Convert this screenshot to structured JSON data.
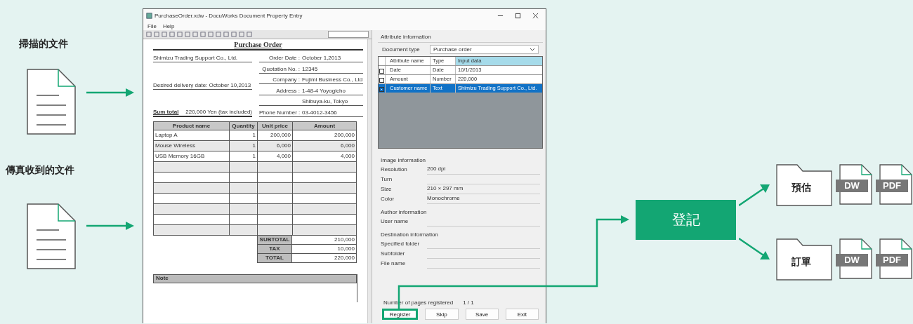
{
  "sources": [
    {
      "label": "掃描的文件"
    },
    {
      "label": "傳真收到的文件"
    }
  ],
  "window": {
    "title": "PurchaseOrder.xdw - DocuWorks Document Property Entry",
    "menu": [
      "File",
      "Help"
    ],
    "document": {
      "title": "Purchase Order",
      "left_fields": [
        "Shimizu Trading Support Co., Ltd.",
        "Desired delivery date: October 10,2013"
      ],
      "sum_total": {
        "label": "Sum total",
        "value": "220,000 Yen (tax included)"
      },
      "right_fields": [
        {
          "label": "Order Date :",
          "value": "October 1,2013"
        },
        {
          "label": "Quotation No. :",
          "value": "12345"
        },
        {
          "label": "Company :",
          "value": "Fujimi Business Co., Ltd"
        },
        {
          "label": "Address :",
          "value": "1-48-4 Yoyogicho"
        },
        {
          "value": "Shibuya-ku, Tokyo"
        },
        {
          "label": "Phone Number :",
          "value": "03-4012-3456"
        }
      ],
      "columns": [
        "Product name",
        "Quantity",
        "Unit price",
        "Amount"
      ],
      "rows": [
        [
          "Laptop A",
          "1",
          "200,000",
          "200,000"
        ],
        [
          "Mouse Wireless",
          "1",
          "6,000",
          "6,000"
        ],
        [
          "USB Memory 16GB",
          "1",
          "4,000",
          "4,000"
        ]
      ],
      "totals": [
        {
          "label": "SUBTOTAL",
          "value": "210,000"
        },
        {
          "label": "TAX",
          "value": "10,000"
        },
        {
          "label": "TOTAL",
          "value": "220,000"
        }
      ],
      "note_label": "Note"
    },
    "panel": {
      "tab": "Attribute information",
      "doc_type_label": "Document type",
      "doc_type": "Purchase order",
      "grid_columns": [
        "Attribute name",
        "Type",
        "Input data"
      ],
      "grid_rows": [
        {
          "checked": false,
          "selected": false,
          "cells": [
            "Date",
            "Date",
            "10/1/2013"
          ]
        },
        {
          "checked": false,
          "selected": false,
          "cells": [
            "Amount",
            "Number",
            "220,000"
          ]
        },
        {
          "checked": true,
          "selected": true,
          "cells": [
            "Customer name",
            "Text",
            "Shimizu Trading Support Co., Ltd."
          ]
        }
      ],
      "sections": [
        {
          "title": "Image information",
          "fields": [
            {
              "label": "Resolution",
              "value": "200 dpi"
            },
            {
              "label": "Turn"
            },
            {
              "label": "Size",
              "value": "210 × 297 mm"
            },
            {
              "label": "Color",
              "value": "Monochrome"
            }
          ]
        },
        {
          "title": "Author information",
          "fields": [
            {
              "label": "User name"
            }
          ]
        },
        {
          "title": "Destination information",
          "fields": [
            {
              "label": "Specified folder"
            },
            {
              "label": "Subfolder"
            },
            {
              "label": "File name"
            }
          ]
        }
      ],
      "pages_label": "Number of pages registered",
      "pages_value": "1 / 1",
      "buttons": [
        {
          "label": "Register",
          "highlighted": true
        },
        {
          "label": "Skip",
          "highlighted": false
        },
        {
          "label": "Save",
          "highlighted": false
        },
        {
          "label": "Exit",
          "highlighted": false
        }
      ]
    }
  },
  "register_step": {
    "label": "登記"
  },
  "outputs": [
    {
      "label": "預估",
      "files": [
        "DW",
        "PDF"
      ]
    },
    {
      "label": "訂單",
      "files": [
        "DW",
        "PDF"
      ]
    }
  ]
}
